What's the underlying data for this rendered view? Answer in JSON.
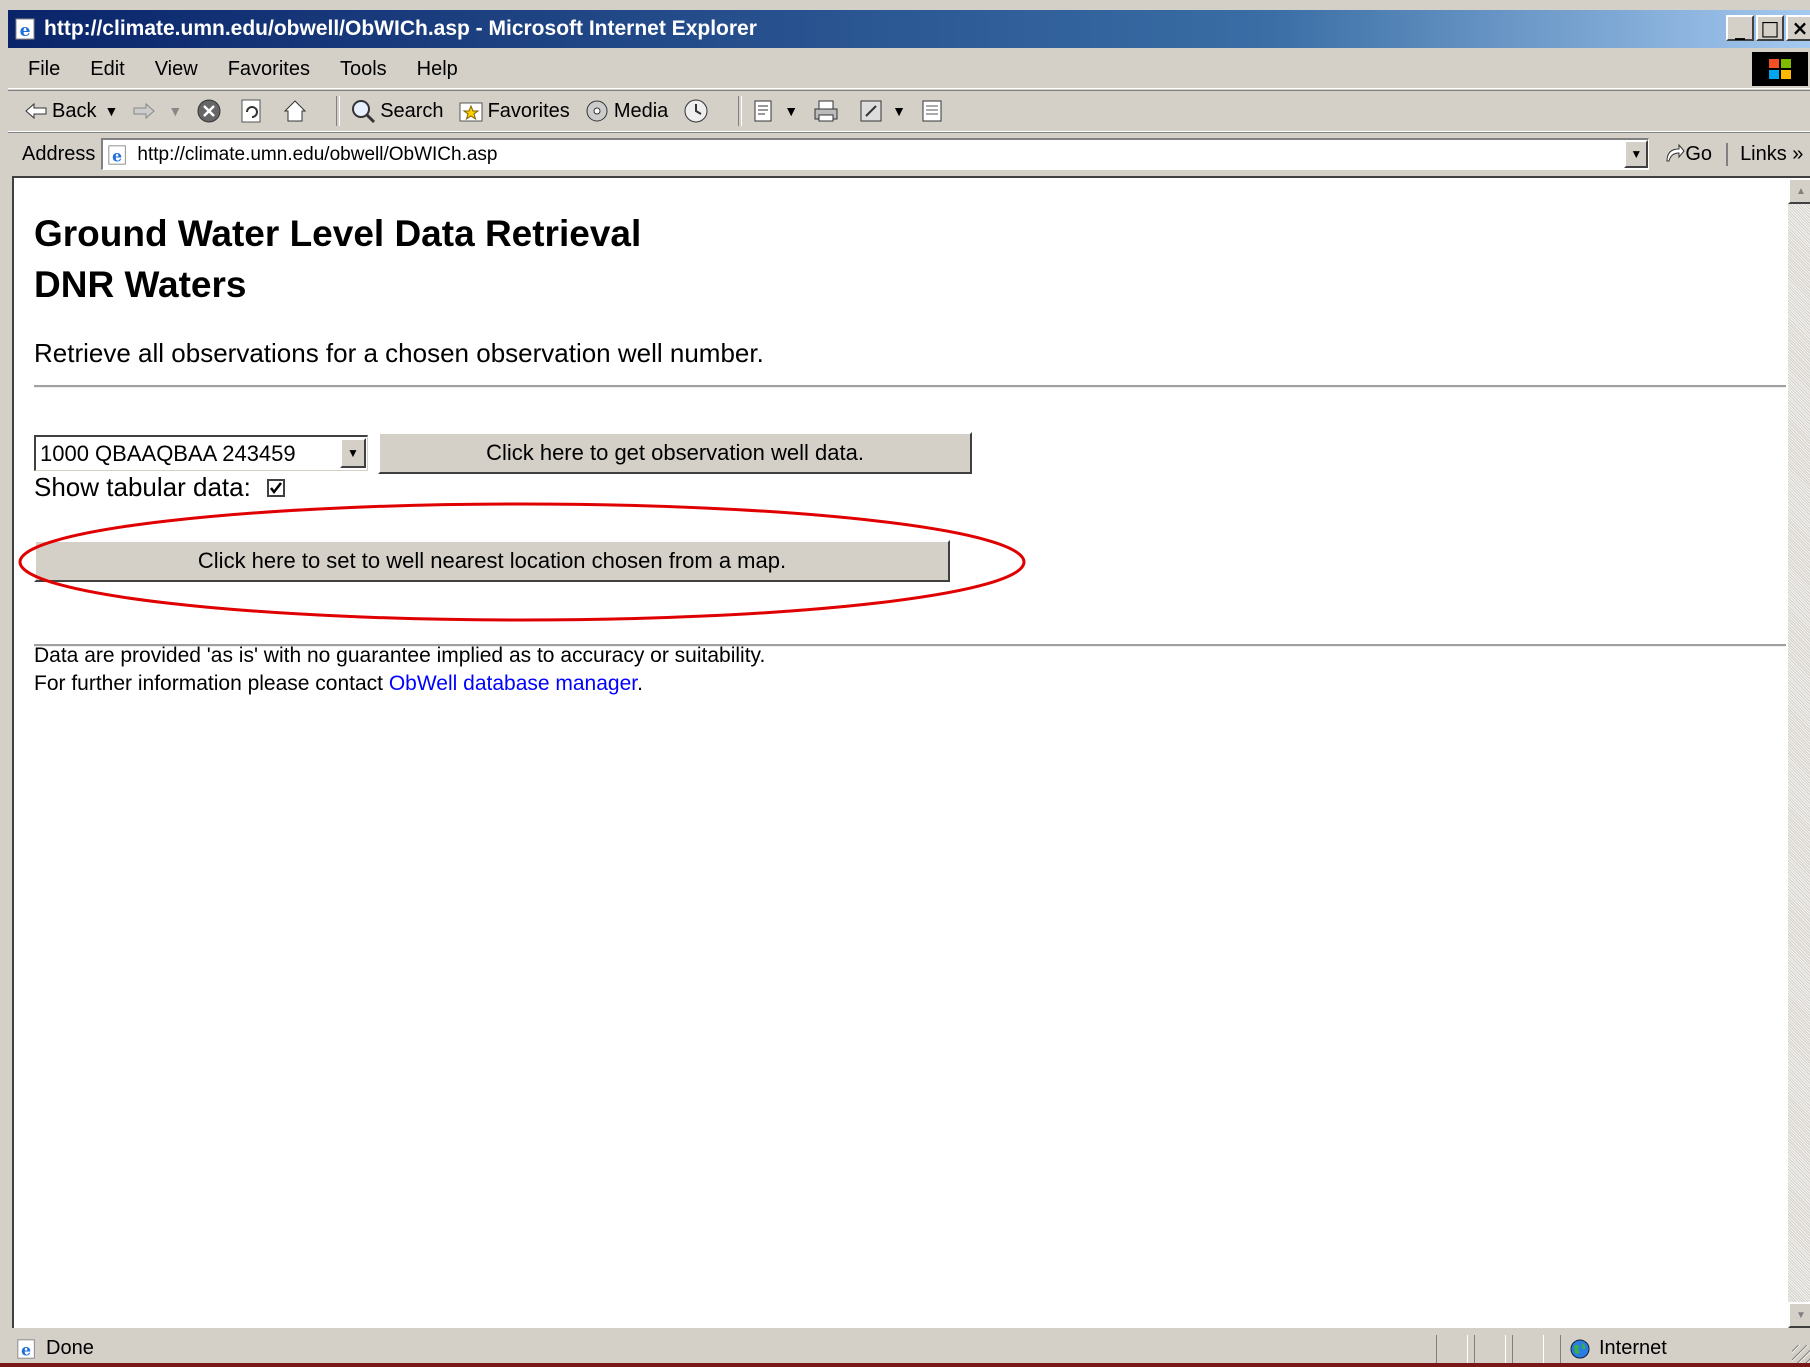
{
  "window": {
    "title": "http://climate.umn.edu/obwell/ObWICh.asp - Microsoft Internet Explorer",
    "controls": {
      "minimize": "_",
      "restore": "□",
      "close": "×"
    }
  },
  "menu": {
    "file": "File",
    "edit": "Edit",
    "view": "View",
    "favorites": "Favorites",
    "tools": "Tools",
    "help": "Help"
  },
  "toolbar": {
    "back": "Back",
    "search": "Search",
    "favorites": "Favorites",
    "media": "Media"
  },
  "address": {
    "label": "Address",
    "url": "http://climate.umn.edu/obwell/ObWICh.asp",
    "go": "Go",
    "links": "Links »"
  },
  "page": {
    "title_line1": "Ground Water Level Data Retrieval",
    "title_line2": "DNR Waters",
    "intro": "Retrieve all observations for a chosen observation well number.",
    "well_select": {
      "selected": "1000 QBAAQBAA 243459"
    },
    "get_data_button": "Click here to get observation well data.",
    "show_tabular_label": "Show tabular data:",
    "show_tabular_checked": true,
    "map_button": "Click here to set to well nearest location chosen from a map.",
    "disclaimer": "Data are provided 'as is' with no guarantee implied as to accuracy or suitability.",
    "contact_prefix": "For further information please contact ",
    "contact_link": "ObWell database manager",
    "contact_suffix": "."
  },
  "status": {
    "text": "Done",
    "zone": "Internet"
  },
  "colors": {
    "titlebar": "#0a246a",
    "chrome": "#d4d0c8",
    "link": "#0000ff",
    "highlight_ellipse": "#e00000",
    "desktop": "#7a1818"
  },
  "icons": [
    "ie-page-icon",
    "back-arrow-icon",
    "forward-arrow-icon",
    "stop-icon",
    "refresh-icon",
    "home-icon",
    "search-icon",
    "favorites-icon",
    "media-icon",
    "history-icon",
    "mail-icon",
    "print-icon",
    "edit-icon",
    "discuss-icon",
    "go-arrow-icon",
    "globe-icon",
    "windows-logo-icon",
    "checkmark-icon"
  ]
}
